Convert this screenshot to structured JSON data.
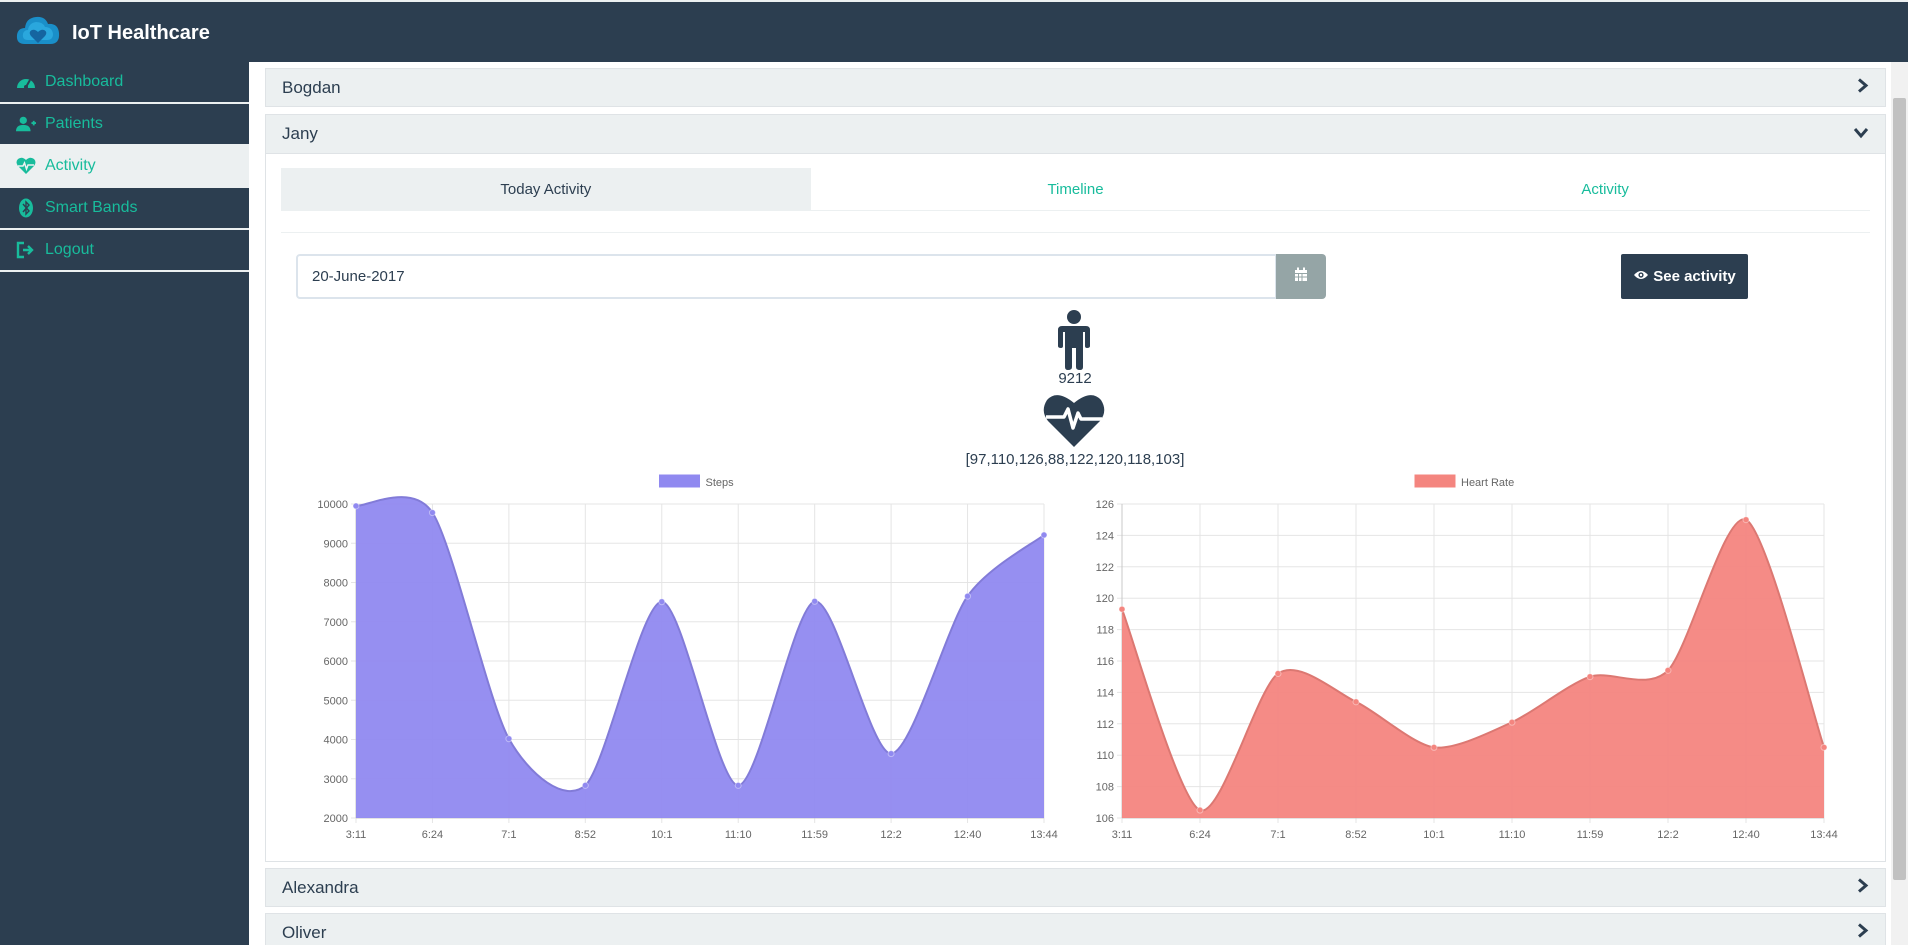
{
  "app": {
    "title": "IoT Healthcare"
  },
  "sidebar": {
    "items": [
      {
        "label": "Dashboard",
        "icon": "dashboard-icon"
      },
      {
        "label": "Patients",
        "icon": "user-plus-icon"
      },
      {
        "label": "Activity",
        "icon": "heartbeat-icon",
        "active": true
      },
      {
        "label": "Smart Bands",
        "icon": "bluetooth-icon"
      },
      {
        "label": "Logout",
        "icon": "sign-out-icon"
      }
    ]
  },
  "patients": [
    {
      "name": "Bogdan",
      "expanded": false
    },
    {
      "name": "Jany",
      "expanded": true
    },
    {
      "name": "Alexandra",
      "expanded": false
    },
    {
      "name": "Oliver",
      "expanded": false
    }
  ],
  "tabs": [
    {
      "label": "Today Activity",
      "active": true
    },
    {
      "label": "Timeline",
      "active": false
    },
    {
      "label": "Activity",
      "active": false
    }
  ],
  "date_field": {
    "value": "20-June-2017"
  },
  "see_activity_label": "See activity",
  "summary": {
    "steps_total": "9212",
    "heart_rates": "[97,110,126,88,122,120,118,103]"
  },
  "colors": {
    "brand": "#2c3e50",
    "accent": "#18bc9c",
    "steps_fill": "#9089f0",
    "heart_fill": "#f4857f"
  },
  "chart_data": [
    {
      "type": "area",
      "x": [
        "3:11",
        "6:24",
        "7:1",
        "8:52",
        "10:1",
        "11:10",
        "11:59",
        "12:2",
        "12:40",
        "13:44"
      ],
      "series": [
        {
          "name": "Steps",
          "values": [
            9950,
            9780,
            4020,
            2830,
            7510,
            2830,
            7520,
            3640,
            7650,
            9210
          ]
        }
      ],
      "ylim": [
        2000,
        10000
      ],
      "yticks": [
        2000,
        3000,
        4000,
        5000,
        6000,
        7000,
        8000,
        9000,
        10000
      ],
      "legend": "top-center",
      "grid": true
    },
    {
      "type": "area",
      "x": [
        "3:11",
        "6:24",
        "7:1",
        "8:52",
        "10:1",
        "11:10",
        "11:59",
        "12:2",
        "12:40",
        "13:44"
      ],
      "series": [
        {
          "name": "Heart Rate",
          "values": [
            119.3,
            106.5,
            115.2,
            113.4,
            110.5,
            112.1,
            115.0,
            115.4,
            125.0,
            110.5
          ]
        }
      ],
      "ylim": [
        106,
        126
      ],
      "yticks": [
        106,
        108,
        110,
        112,
        114,
        116,
        118,
        120,
        122,
        124,
        126
      ],
      "legend": "top-center",
      "grid": true
    }
  ]
}
